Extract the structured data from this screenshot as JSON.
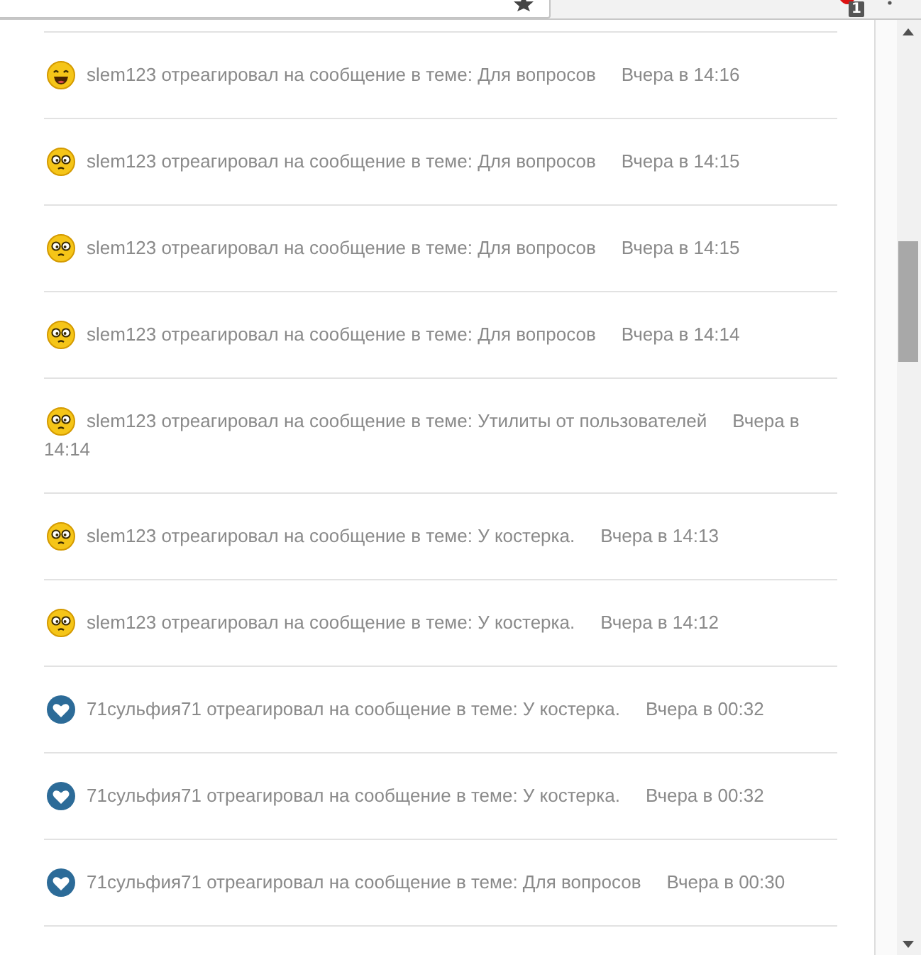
{
  "toolbar": {
    "badge": "1"
  },
  "alerts": [
    {
      "kind": "laugh",
      "user": "slem123",
      "action": "отреагировал на сообщение в теме:",
      "topic": "Для вопросов",
      "time": "Вчера в 14:16"
    },
    {
      "kind": "confused",
      "user": "slem123",
      "action": "отреагировал на сообщение в теме:",
      "topic": "Для вопросов",
      "time": "Вчера в 14:15"
    },
    {
      "kind": "confused",
      "user": "slem123",
      "action": "отреагировал на сообщение в теме:",
      "topic": "Для вопросов",
      "time": "Вчера в 14:15"
    },
    {
      "kind": "confused",
      "user": "slem123",
      "action": "отреагировал на сообщение в теме:",
      "topic": "Для вопросов",
      "time": "Вчера в 14:14"
    },
    {
      "kind": "confused",
      "user": "slem123",
      "action": "отреагировал на сообщение в теме:",
      "topic": "Утилиты от пользователей",
      "time": "Вчера в 14:14"
    },
    {
      "kind": "confused",
      "user": "slem123",
      "action": "отреагировал на сообщение в теме:",
      "topic": "У костерка.",
      "time": "Вчера в 14:13"
    },
    {
      "kind": "confused",
      "user": "slem123",
      "action": "отреагировал на сообщение в теме:",
      "topic": "У костерка.",
      "time": "Вчера в 14:12"
    },
    {
      "kind": "heart",
      "user": "71сульфия71",
      "action": "отреагировал на сообщение в теме:",
      "topic": "У костерка.",
      "time": "Вчера в 00:32"
    },
    {
      "kind": "heart",
      "user": "71сульфия71",
      "action": "отреагировал на сообщение в теме:",
      "topic": "У костерка.",
      "time": "Вчера в 00:32"
    },
    {
      "kind": "heart",
      "user": "71сульфия71",
      "action": "отреагировал на сообщение в теме:",
      "topic": "Для вопросов",
      "time": "Вчера в 00:30"
    }
  ]
}
